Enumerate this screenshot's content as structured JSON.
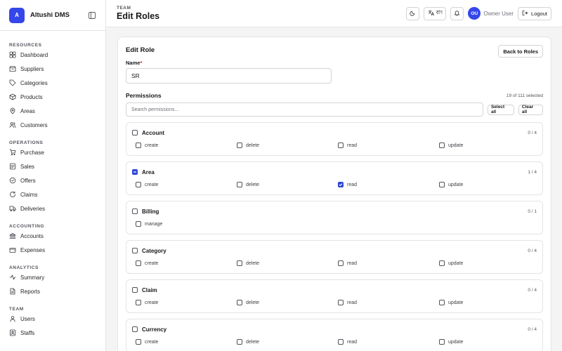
{
  "brand": {
    "logo_letter": "A",
    "name": "Altushi DMS"
  },
  "sidebar": {
    "sections": [
      {
        "title": "RESOURCES",
        "items": [
          {
            "label": "Dashboard",
            "icon": "dashboard-icon"
          },
          {
            "label": "Suppliers",
            "icon": "suppliers-icon"
          },
          {
            "label": "Categories",
            "icon": "tag-icon"
          },
          {
            "label": "Products",
            "icon": "box-icon"
          },
          {
            "label": "Areas",
            "icon": "map-pin-icon"
          },
          {
            "label": "Customers",
            "icon": "users-icon"
          }
        ]
      },
      {
        "title": "OPERATIONS",
        "items": [
          {
            "label": "Purchase",
            "icon": "cart-icon"
          },
          {
            "label": "Sales",
            "icon": "receipt-icon"
          },
          {
            "label": "Offers",
            "icon": "badge-icon"
          },
          {
            "label": "Claims",
            "icon": "refresh-icon"
          },
          {
            "label": "Deliveries",
            "icon": "truck-icon"
          }
        ]
      },
      {
        "title": "ACCOUNTING",
        "items": [
          {
            "label": "Accounts",
            "icon": "bank-icon"
          },
          {
            "label": "Expenses",
            "icon": "wallet-icon"
          }
        ]
      },
      {
        "title": "ANALYTICS",
        "items": [
          {
            "label": "Summary",
            "icon": "activity-icon"
          },
          {
            "label": "Reports",
            "icon": "file-icon"
          }
        ]
      },
      {
        "title": "TEAM",
        "items": [
          {
            "label": "Users",
            "icon": "user-icon"
          },
          {
            "label": "Staffs",
            "icon": "staff-icon"
          }
        ]
      }
    ]
  },
  "header": {
    "crumb": "TEAM",
    "title": "Edit Roles",
    "lang_label": "বাং",
    "avatar_initials": "OU",
    "user_name": "Owner User",
    "logout_label": "Logout"
  },
  "form": {
    "card_title": "Edit Role",
    "back_label": "Back to Roles",
    "name_label": "Name",
    "name_required": "*",
    "name_value": "SR",
    "permissions_label": "Permissions",
    "selected_count": "19 of 111 selected",
    "search_placeholder": "Search permissions...",
    "select_all_label": "Select all",
    "clear_all_label": "Clear all"
  },
  "groups": [
    {
      "name": "Account",
      "count": "0 / 4",
      "state": "none",
      "actions": [
        {
          "label": "create",
          "checked": false
        },
        {
          "label": "delete",
          "checked": false
        },
        {
          "label": "read",
          "checked": false
        },
        {
          "label": "update",
          "checked": false
        }
      ]
    },
    {
      "name": "Area",
      "count": "1 / 4",
      "state": "partial",
      "actions": [
        {
          "label": "create",
          "checked": false
        },
        {
          "label": "delete",
          "checked": false
        },
        {
          "label": "read",
          "checked": true
        },
        {
          "label": "update",
          "checked": false
        }
      ]
    },
    {
      "name": "Billing",
      "count": "0 / 1",
      "state": "none",
      "actions": [
        {
          "label": "manage",
          "checked": false
        }
      ]
    },
    {
      "name": "Category",
      "count": "0 / 4",
      "state": "none",
      "actions": [
        {
          "label": "create",
          "checked": false
        },
        {
          "label": "delete",
          "checked": false
        },
        {
          "label": "read",
          "checked": false
        },
        {
          "label": "update",
          "checked": false
        }
      ]
    },
    {
      "name": "Claim",
      "count": "0 / 4",
      "state": "none",
      "actions": [
        {
          "label": "create",
          "checked": false
        },
        {
          "label": "delete",
          "checked": false
        },
        {
          "label": "read",
          "checked": false
        },
        {
          "label": "update",
          "checked": false
        }
      ]
    },
    {
      "name": "Currency",
      "count": "0 / 4",
      "state": "none",
      "actions": [
        {
          "label": "create",
          "checked": false
        },
        {
          "label": "delete",
          "checked": false
        },
        {
          "label": "read",
          "checked": false
        },
        {
          "label": "update",
          "checked": false
        }
      ]
    }
  ],
  "colors": {
    "accent": "#3547e8",
    "required": "#dc2626"
  }
}
